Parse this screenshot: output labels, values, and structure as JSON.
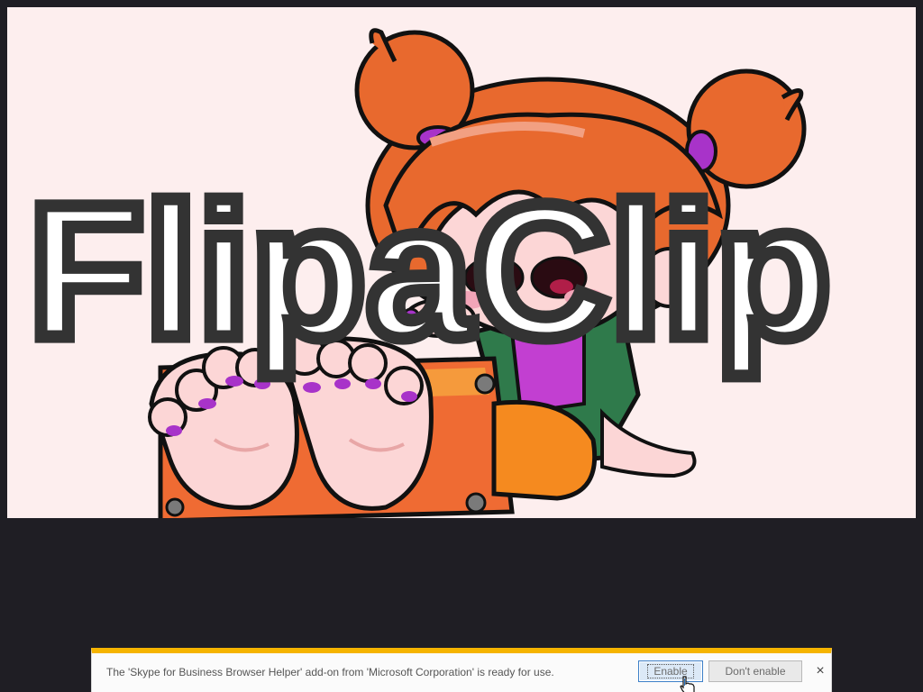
{
  "video": {
    "watermark_text": "FlipaClip",
    "background_color": "#fdeeee"
  },
  "notification": {
    "message": "The 'Skype for Business Browser Helper' add-on from 'Microsoft Corporation' is ready for use.",
    "enable_label": "Enable",
    "dont_enable_label": "Don't enable",
    "close_glyph": "×",
    "accent_color": "#f5b400"
  },
  "icons": {
    "close": "close-icon",
    "cursor": "hand-pointer-icon"
  }
}
